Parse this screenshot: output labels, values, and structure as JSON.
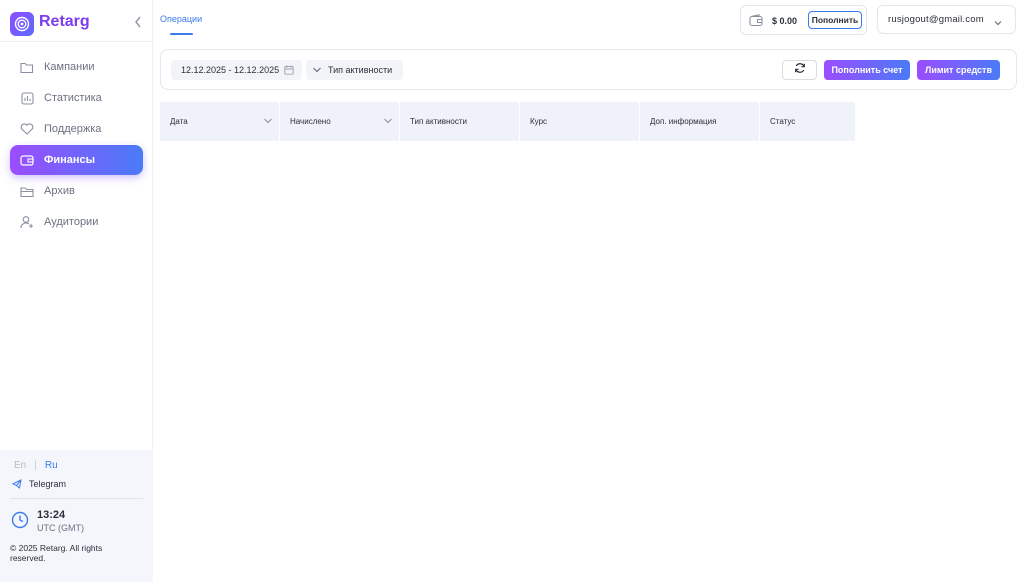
{
  "brand": {
    "name": "Retarg"
  },
  "sidebar": {
    "items": [
      {
        "label": "Кампании",
        "icon": "folder-icon",
        "active": false
      },
      {
        "label": "Статистика",
        "icon": "chart-icon",
        "active": false
      },
      {
        "label": "Поддержка",
        "icon": "heart-icon",
        "active": false
      },
      {
        "label": "Финансы",
        "icon": "wallet-icon",
        "active": true
      },
      {
        "label": "Архив",
        "icon": "archive-icon",
        "active": false
      },
      {
        "label": "Аудитории",
        "icon": "add-user-icon",
        "active": false
      }
    ]
  },
  "footer": {
    "lang_en": "En",
    "lang_sep": "|",
    "lang_ru": "Ru",
    "telegram": "Telegram",
    "time": "13:24",
    "timezone": "UTC (GMT)",
    "copyright": "© 2025 Retarg. All rights reserved."
  },
  "tabs": {
    "operations": "Операции"
  },
  "balance": {
    "amount": "$ 0.00",
    "topup_label": "Пополнить"
  },
  "user": {
    "email": "rusjogout@gmail.com"
  },
  "filters": {
    "date_range": "12.12.2025 - 12.12.2025",
    "activity_type": "Тип активности"
  },
  "actions": {
    "deposit": "Пополнить счет",
    "limit": "Лимит средств"
  },
  "table": {
    "columns": [
      "Дата",
      "Начислено",
      "Тип активности",
      "Курс",
      "Доп. информация",
      "Статус"
    ]
  },
  "colors": {
    "accent": "#3a7bef",
    "brand": "#7d3cf0",
    "gradient_start": "#9b4dff",
    "gradient_end": "#4a7bf7"
  }
}
